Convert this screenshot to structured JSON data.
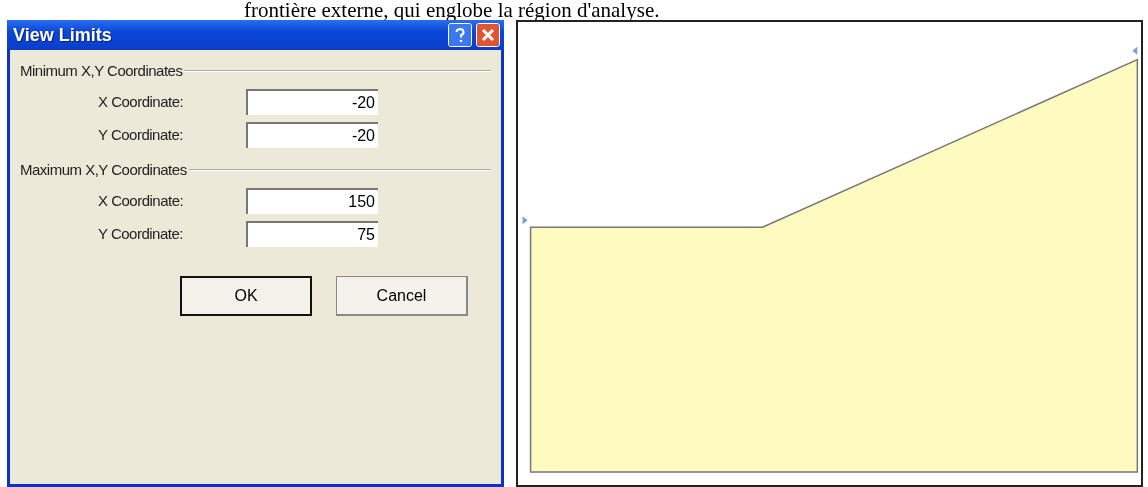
{
  "caption": "frontière externe, qui englobe la région d'analyse.",
  "dialog": {
    "title": "View Limits",
    "groups": [
      {
        "label": "Minimum X,Y Coordinates",
        "fields": [
          {
            "label": "X Coordinate:",
            "value": "-20"
          },
          {
            "label": "Y Coordinate:",
            "value": "-20"
          }
        ]
      },
      {
        "label": "Maximum X,Y Coordinates",
        "fields": [
          {
            "label": "X Coordinate:",
            "value": "150"
          },
          {
            "label": "Y Coordinate:",
            "value": "75"
          }
        ]
      }
    ],
    "buttons": [
      {
        "label": "OK",
        "kind": "default"
      },
      {
        "label": "Cancel",
        "kind": "normal"
      }
    ]
  },
  "canvas": {
    "kind": "boundary"
  }
}
